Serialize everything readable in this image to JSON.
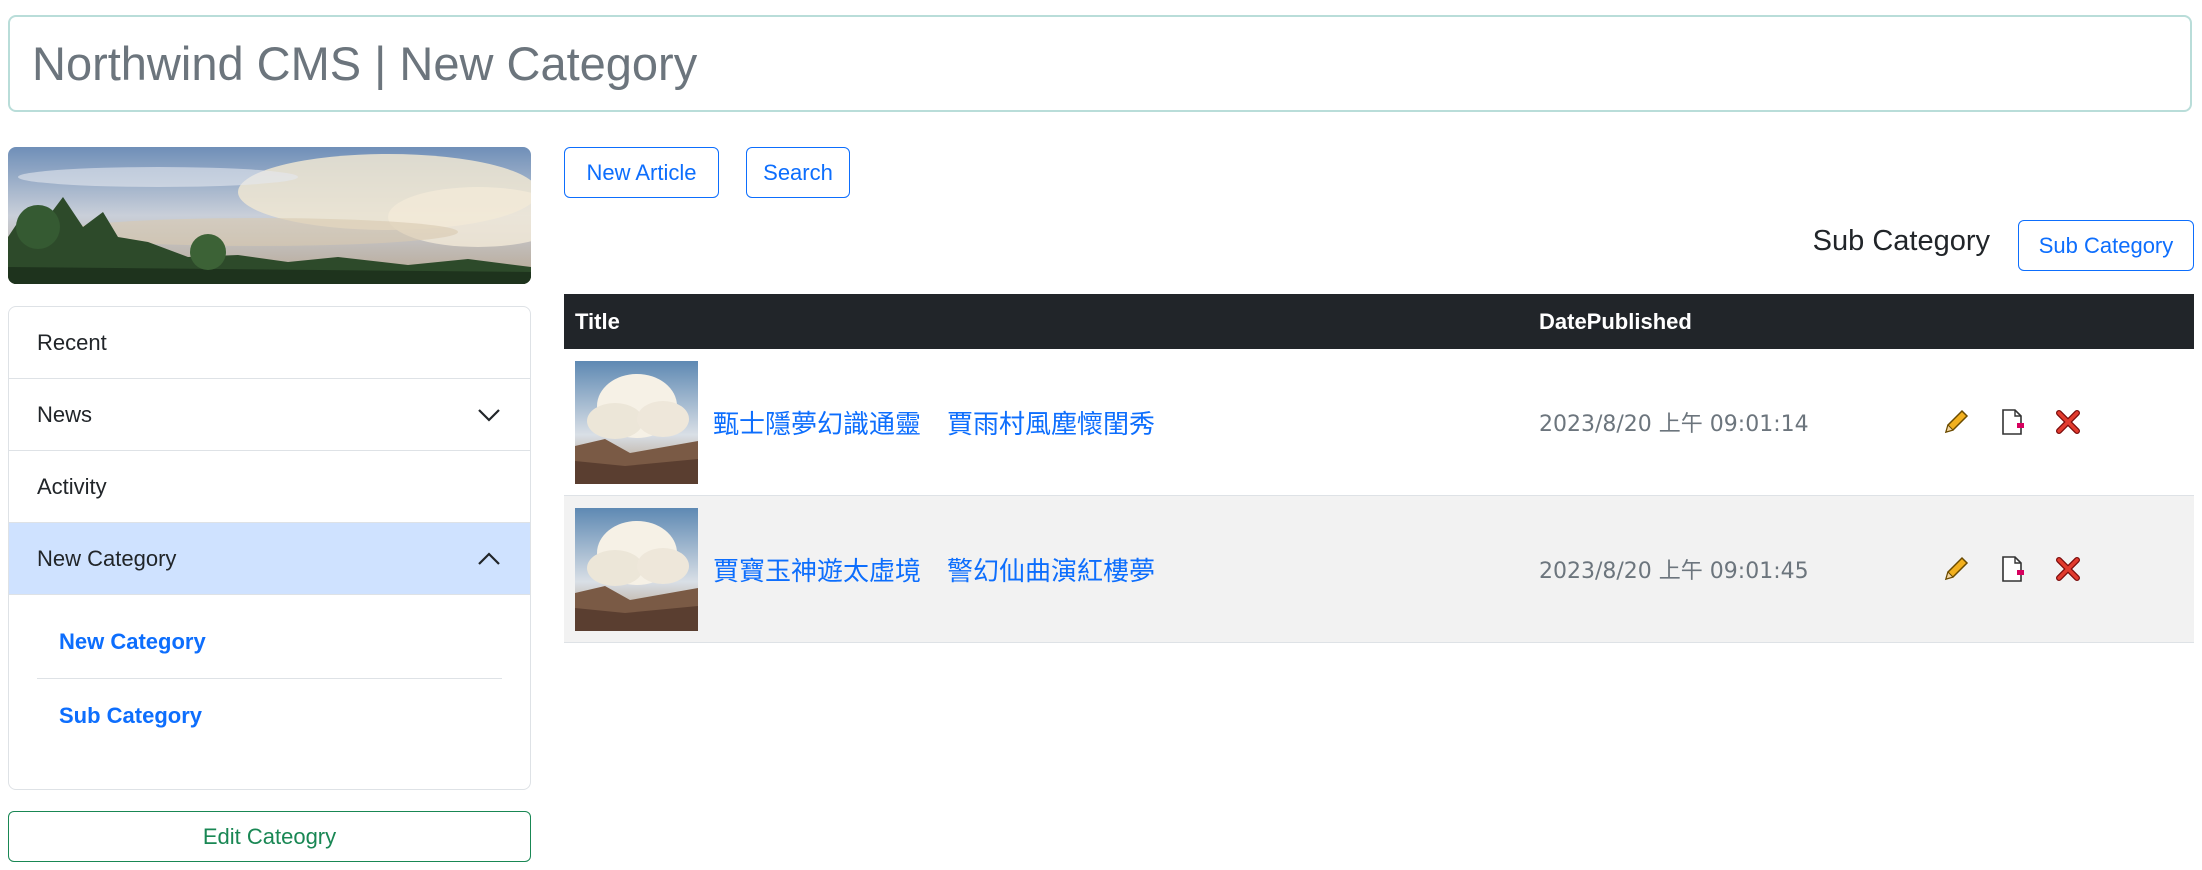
{
  "header": {
    "title": "Northwind CMS | New Category"
  },
  "sidebar": {
    "items": [
      {
        "label": "Recent"
      },
      {
        "label": "News"
      },
      {
        "label": "Activity"
      },
      {
        "label": "New Category"
      }
    ],
    "subitems": [
      {
        "label": "New Category"
      },
      {
        "label": "Sub Category"
      }
    ],
    "edit_label": "Edit Cateogry"
  },
  "toolbar": {
    "new_article_label": "New Article",
    "search_label": "Search"
  },
  "subcategory": {
    "text": "Sub Category",
    "button_label": "Sub Category"
  },
  "table": {
    "headers": {
      "title": "Title",
      "date": "DatePublished"
    },
    "rows": [
      {
        "title": "甄士隱夢幻識通靈　賈雨村風塵懷閨秀",
        "date": "2023/8/20 上午 09:01:14"
      },
      {
        "title": "賈寶玉神遊太虛境　警幻仙曲演紅樓夢",
        "date": "2023/8/20 上午 09:01:45"
      }
    ]
  },
  "colors": {
    "accent": "#0d6efd",
    "success": "#198754",
    "active_bg": "#cfe2ff",
    "table_header": "#212529"
  }
}
